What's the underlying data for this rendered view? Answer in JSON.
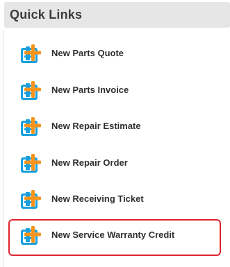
{
  "panel": {
    "title": "Quick Links"
  },
  "links": [
    {
      "label": "New Parts Quote",
      "icon": "add-document-icon",
      "highlighted": false
    },
    {
      "label": "New Parts Invoice",
      "icon": "add-document-icon",
      "highlighted": false
    },
    {
      "label": "New Repair Estimate",
      "icon": "add-document-icon",
      "highlighted": false
    },
    {
      "label": "New Repair Order",
      "icon": "add-document-icon",
      "highlighted": false
    },
    {
      "label": "New Receiving Ticket",
      "icon": "add-document-icon",
      "highlighted": false
    },
    {
      "label": "New Service Warranty Credit",
      "icon": "add-document-icon",
      "highlighted": true
    }
  ],
  "colors": {
    "icon_blue": "#1aa0dc",
    "icon_orange": "#f7941d",
    "highlight_border": "#e0242b",
    "header_bg": "#e6e6e6"
  }
}
